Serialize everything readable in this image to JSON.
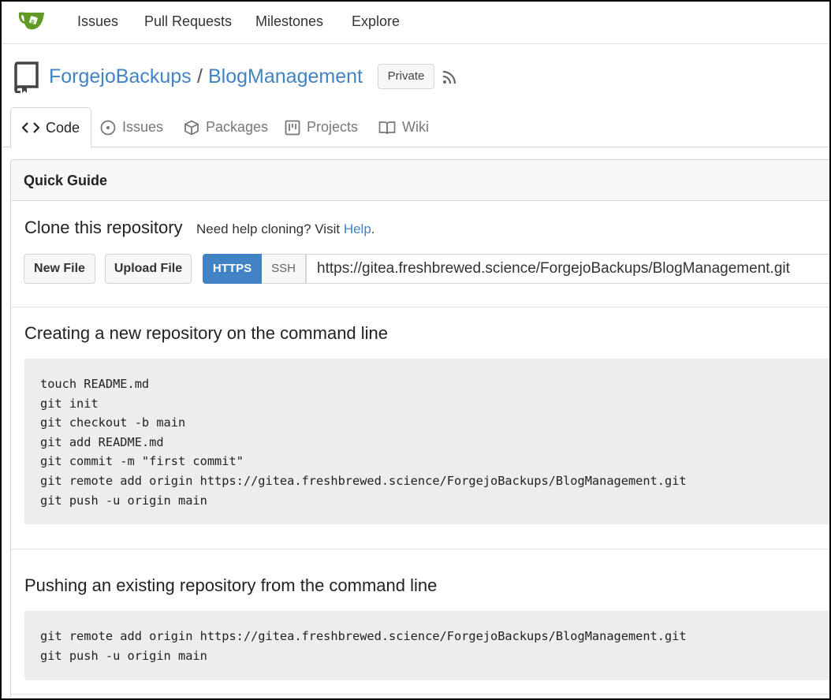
{
  "nav": {
    "items": [
      "Issues",
      "Pull Requests",
      "Milestones",
      "Explore"
    ]
  },
  "repo": {
    "owner": "ForgejoBackups",
    "separator": "/",
    "name": "BlogManagement",
    "badge": "Private"
  },
  "tabs": [
    {
      "label": "Code",
      "icon": "code-icon",
      "active": true
    },
    {
      "label": "Issues",
      "icon": "issue-icon",
      "active": false
    },
    {
      "label": "Packages",
      "icon": "package-icon",
      "active": false
    },
    {
      "label": "Projects",
      "icon": "project-icon",
      "active": false
    },
    {
      "label": "Wiki",
      "icon": "book-icon",
      "active": false
    }
  ],
  "guide": {
    "title": "Quick Guide",
    "clone_title": "Clone this repository",
    "help_prefix": "Need help cloning? Visit",
    "help_link": "Help",
    "help_suffix": ".",
    "new_file": "New File",
    "upload_file": "Upload File",
    "https_label": "HTTPS",
    "ssh_label": "SSH",
    "clone_url": "https://gitea.freshbrewed.science/ForgejoBackups/BlogManagement.git"
  },
  "new_repo": {
    "title": "Creating a new repository on the command line",
    "lines": [
      "touch README.md",
      "git init",
      "git checkout -b main",
      "git add README.md",
      "git commit -m \"first commit\"",
      "git remote add origin https://gitea.freshbrewed.science/ForgejoBackups/BlogManagement.git",
      "git push -u origin main"
    ]
  },
  "existing_repo": {
    "title": "Pushing an existing repository from the command line",
    "lines": [
      "git remote add origin https://gitea.freshbrewed.science/ForgejoBackups/BlogManagement.git",
      "git push -u origin main"
    ]
  },
  "colors": {
    "link": "#4183c4",
    "logo_green": "#609926",
    "code_bg": "#ededed"
  }
}
